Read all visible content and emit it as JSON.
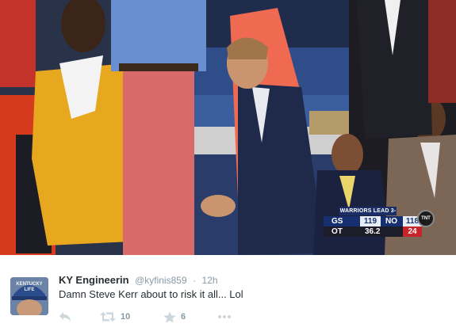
{
  "scoreboard": {
    "banner": "WARRIORS LEAD 3-2",
    "team_a": "GS",
    "score_a": "119",
    "team_b": "NO",
    "score_b": "118",
    "period": "OT",
    "clock": "36.2",
    "shot_clock": "24",
    "network": "TNT"
  },
  "tweet": {
    "avatar_text": "KENTUCKY LIFE",
    "author_name": "KY Engineerin",
    "author_handle": "@kyfinis859",
    "separator": "·",
    "timestamp": "12h",
    "text": "Damn Steve Kerr about to risk it all... Lol",
    "retweet_count": "10",
    "favorite_count": "6"
  },
  "icons": {
    "reply": "reply-icon",
    "retweet": "retweet-icon",
    "favorite": "star-icon",
    "more": "more-icon"
  },
  "colors": {
    "icon_gray": "#ccd6dd",
    "text_gray": "#8899a6",
    "text_dark": "#292f33"
  }
}
